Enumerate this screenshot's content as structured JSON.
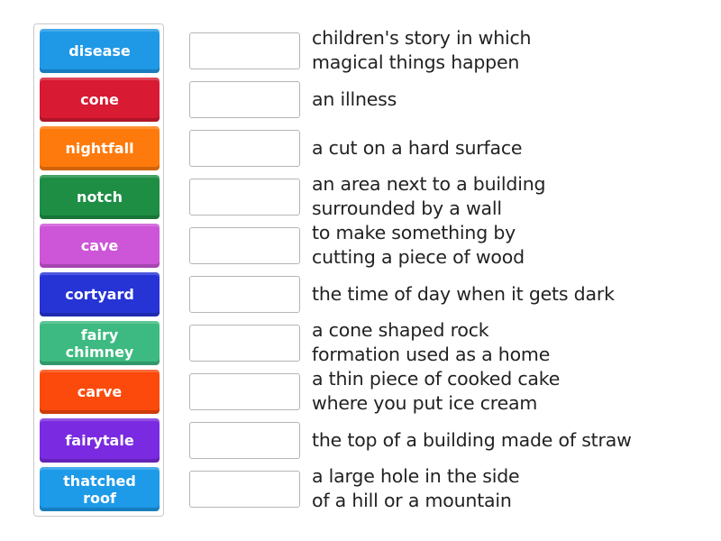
{
  "tiles": [
    {
      "label": "disease",
      "color": "#1f98e6"
    },
    {
      "label": "cone",
      "color": "#d81a33"
    },
    {
      "label": "nightfall",
      "color": "#ff7a0c"
    },
    {
      "label": "notch",
      "color": "#1e8e45"
    },
    {
      "label": "cave",
      "color": "#cc55d8"
    },
    {
      "label": "cortyard",
      "color": "#2634d6"
    },
    {
      "label": "fairy chimney",
      "color": "#3dba81"
    },
    {
      "label": "carve",
      "color": "#fb4a0b"
    },
    {
      "label": "fairytale",
      "color": "#7a2ae0"
    },
    {
      "label": "thatched roof",
      "color": "#1d9ae8"
    }
  ],
  "definitions": [
    "children's story in which\nmagical things happen",
    "an illness",
    "a cut on a hard surface",
    "an area next to a building\nsurrounded by a wall",
    "to make something by\ncutting a piece of wood",
    "the time of day when it gets dark",
    "a cone shaped rock\nformation used as a home",
    "a thin piece of cooked cake\nwhere you put ice cream",
    "the top of a building made of straw",
    "a large hole in the side\nof a hill or a mountain"
  ],
  "answer_boxes": [
    "",
    "",
    "",
    "",
    "",
    "",
    "",
    "",
    "",
    ""
  ]
}
